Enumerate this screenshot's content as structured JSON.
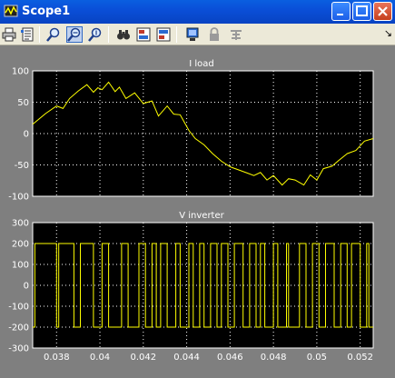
{
  "window": {
    "title": "Scope1"
  },
  "toolbar": {
    "buttons": [
      "print-icon",
      "parameters-icon",
      "zoom-icon",
      "zoom-x-icon",
      "zoom-y-icon",
      "autoscale-icon",
      "save-axes-icon",
      "restore-axes-icon",
      "floating-scope-icon",
      "lock-icon",
      "signal-selection-icon"
    ],
    "dock_glyph": "↘"
  },
  "colors": {
    "trace": "#ffff00",
    "axes_bg": "#000000",
    "figure_bg": "#7f7f7f",
    "grid": "#ffffff"
  },
  "chart_data": [
    {
      "type": "line",
      "title": "I load",
      "xlim": [
        0.0369,
        0.0526
      ],
      "ylim": [
        -100,
        100
      ],
      "yticks": [
        -100,
        -50,
        0,
        50,
        100
      ],
      "grid": true,
      "series": [
        {
          "x": [
            0.0369,
            0.0375,
            0.038,
            0.0383,
            0.0386,
            0.039,
            0.0394,
            0.0397,
            0.0399,
            0.0401,
            0.0404,
            0.0407,
            0.0409,
            0.0412,
            0.0416,
            0.042,
            0.0424,
            0.0427,
            0.0431,
            0.0434,
            0.0437,
            0.0441,
            0.0444,
            0.0448,
            0.0452,
            0.0456,
            0.046,
            0.0464,
            0.0468,
            0.0471,
            0.0474,
            0.0477,
            0.048,
            0.0484,
            0.0487,
            0.049,
            0.0494,
            0.0497,
            0.05,
            0.0503,
            0.0507,
            0.051,
            0.0514,
            0.0518,
            0.0522,
            0.0526
          ],
          "y": [
            15,
            32,
            44,
            40,
            56,
            68,
            78,
            66,
            73,
            70,
            82,
            67,
            74,
            56,
            65,
            48,
            52,
            28,
            44,
            31,
            30,
            5,
            -8,
            -18,
            -32,
            -44,
            -53,
            -58,
            -63,
            -67,
            -62,
            -74,
            -67,
            -82,
            -72,
            -74,
            -82,
            -66,
            -74,
            -56,
            -52,
            -43,
            -32,
            -27,
            -12,
            -8
          ]
        }
      ]
    },
    {
      "type": "line",
      "title": "V inverter",
      "xlim": [
        0.0369,
        0.0526
      ],
      "ylim": [
        -300,
        300
      ],
      "yticks": [
        -300,
        -200,
        -100,
        0,
        100,
        200,
        300
      ],
      "xticks": [
        0.038,
        0.04,
        0.042,
        0.044,
        0.046,
        0.048,
        0.05,
        0.052
      ],
      "xtick_labels": [
        "0.038",
        "0.04",
        "0.042",
        "0.044",
        "0.046",
        "0.048",
        "0.05",
        "0.052"
      ],
      "grid": true,
      "series": [
        {
          "x": [
            0.0369,
            0.037,
            0.037,
            0.038,
            0.038,
            0.0381,
            0.0381,
            0.0388,
            0.0388,
            0.0391,
            0.0391,
            0.0397,
            0.0397,
            0.0401,
            0.0401,
            0.0404,
            0.0404,
            0.041,
            0.041,
            0.0413,
            0.0413,
            0.0418,
            0.0418,
            0.0421,
            0.0421,
            0.0424,
            0.0424,
            0.0426,
            0.0426,
            0.0428,
            0.0428,
            0.0431,
            0.0431,
            0.0435,
            0.0435,
            0.0437,
            0.0437,
            0.0441,
            0.0441,
            0.0443,
            0.0443,
            0.0446,
            0.0446,
            0.0448,
            0.0448,
            0.0451,
            0.0451,
            0.0454,
            0.0454,
            0.0456,
            0.0456,
            0.0459,
            0.0459,
            0.0462,
            0.0462,
            0.0466,
            0.0466,
            0.0469,
            0.0469,
            0.0472,
            0.0472,
            0.0474,
            0.0474,
            0.0476,
            0.0476,
            0.048,
            0.048,
            0.0482,
            0.0482,
            0.0486,
            0.0486,
            0.0487,
            0.0487,
            0.0492,
            0.0492,
            0.0495,
            0.0495,
            0.0498,
            0.0498,
            0.0501,
            0.0501,
            0.0504,
            0.0504,
            0.0508,
            0.0508,
            0.0511,
            0.0511,
            0.0514,
            0.0514,
            0.0516,
            0.0516,
            0.052,
            0.052,
            0.0523,
            0.0523,
            0.0524,
            0.0524,
            0.0526
          ],
          "y": [
            -200,
            -200,
            200,
            200,
            -200,
            -200,
            200,
            200,
            -200,
            -200,
            200,
            200,
            -200,
            -200,
            200,
            200,
            -200,
            -200,
            200,
            200,
            -200,
            -200,
            200,
            200,
            -200,
            -200,
            200,
            200,
            -200,
            -200,
            200,
            200,
            -200,
            -200,
            200,
            200,
            -200,
            -200,
            200,
            200,
            -200,
            -200,
            200,
            200,
            -200,
            -200,
            200,
            200,
            -200,
            -200,
            200,
            200,
            -200,
            -200,
            200,
            200,
            -200,
            -200,
            200,
            200,
            -200,
            -200,
            200,
            200,
            -200,
            -200,
            200,
            200,
            -200,
            -200,
            200,
            200,
            -200,
            -200,
            200,
            200,
            -200,
            -200,
            200,
            200,
            -200,
            -200,
            200,
            200,
            -200,
            -200,
            200,
            200,
            -200,
            -200,
            200,
            200,
            -200,
            -200,
            200,
            200,
            -200,
            -200
          ]
        }
      ]
    }
  ]
}
